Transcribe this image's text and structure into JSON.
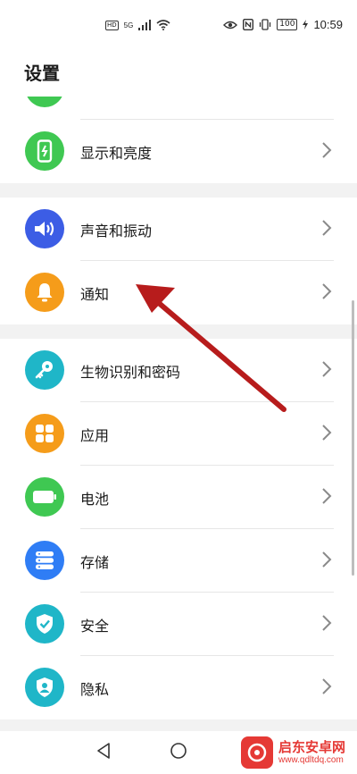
{
  "status_bar": {
    "hd": "HD",
    "signal": "5G",
    "battery": "100",
    "time": "10:59"
  },
  "header": {
    "title": "设置"
  },
  "settings": [
    {
      "label": "显示和亮度",
      "icon": "display-brightness-icon",
      "color": "#3fc852"
    },
    {
      "label": "声音和振动",
      "icon": "speaker-icon",
      "color": "#3c5de5"
    },
    {
      "label": "通知",
      "icon": "bell-icon",
      "color": "#f59c1a"
    },
    {
      "label": "生物识别和密码",
      "icon": "key-icon",
      "color": "#1fb6c8"
    },
    {
      "label": "应用",
      "icon": "apps-grid-icon",
      "color": "#f59c1a"
    },
    {
      "label": "电池",
      "icon": "battery-icon",
      "color": "#3fc852"
    },
    {
      "label": "存储",
      "icon": "storage-icon",
      "color": "#2f7df5"
    },
    {
      "label": "安全",
      "icon": "shield-check-icon",
      "color": "#1fb6c8"
    },
    {
      "label": "隐私",
      "icon": "privacy-icon",
      "color": "#1fb6c8"
    }
  ],
  "watermark": {
    "title": "启东安卓网",
    "url": "www.qdltdq.com"
  },
  "accent": {
    "arrow": "#b71c1c"
  }
}
